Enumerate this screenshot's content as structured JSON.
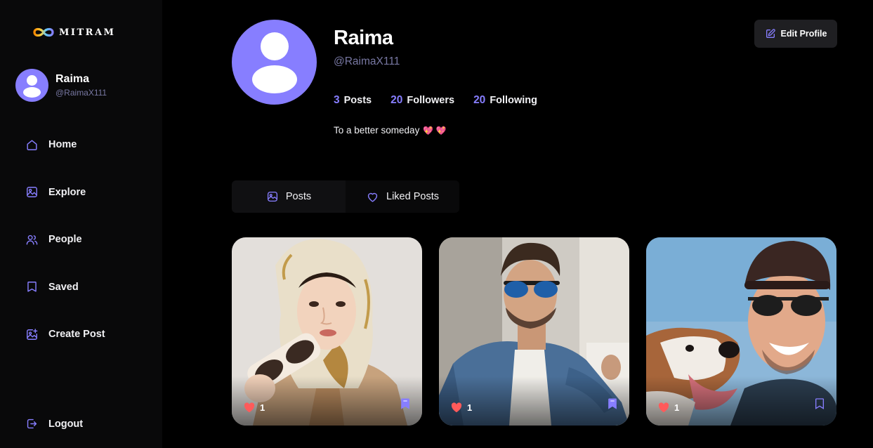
{
  "brand": {
    "name": "MITRAM"
  },
  "colors": {
    "accent": "#877eff",
    "background": "#000000",
    "sidebar": "#09090a",
    "muted": "#7878a3",
    "like": "#ff5a5a"
  },
  "user": {
    "name": "Raima",
    "handle": "@RaimaX111"
  },
  "sidebar": {
    "items": [
      {
        "label": "Home",
        "icon": "home-icon"
      },
      {
        "label": "Explore",
        "icon": "explore-icon"
      },
      {
        "label": "People",
        "icon": "people-icon"
      },
      {
        "label": "Saved",
        "icon": "bookmark-icon"
      },
      {
        "label": "Create Post",
        "icon": "create-post-icon"
      }
    ],
    "logout_label": "Logout"
  },
  "profile": {
    "name": "Raima",
    "handle": "@RaimaX111",
    "stats": [
      {
        "value": "3",
        "label": "Posts"
      },
      {
        "value": "20",
        "label": "Followers"
      },
      {
        "value": "20",
        "label": "Following"
      }
    ],
    "bio": "To a better someday",
    "bio_emoji": "💖 💖",
    "edit_label": "Edit Profile"
  },
  "tabs": [
    {
      "label": "Posts",
      "icon": "posts-icon",
      "active": true
    },
    {
      "label": "Liked Posts",
      "icon": "heart-outline-icon",
      "active": false
    }
  ],
  "posts": [
    {
      "likes": "1",
      "photo": "woman-with-headscarf-and-sunglasses"
    },
    {
      "likes": "1",
      "photo": "man-in-denim-shirt-with-sunglasses"
    },
    {
      "likes": "1",
      "photo": "man-in-cap-with-dog"
    }
  ]
}
